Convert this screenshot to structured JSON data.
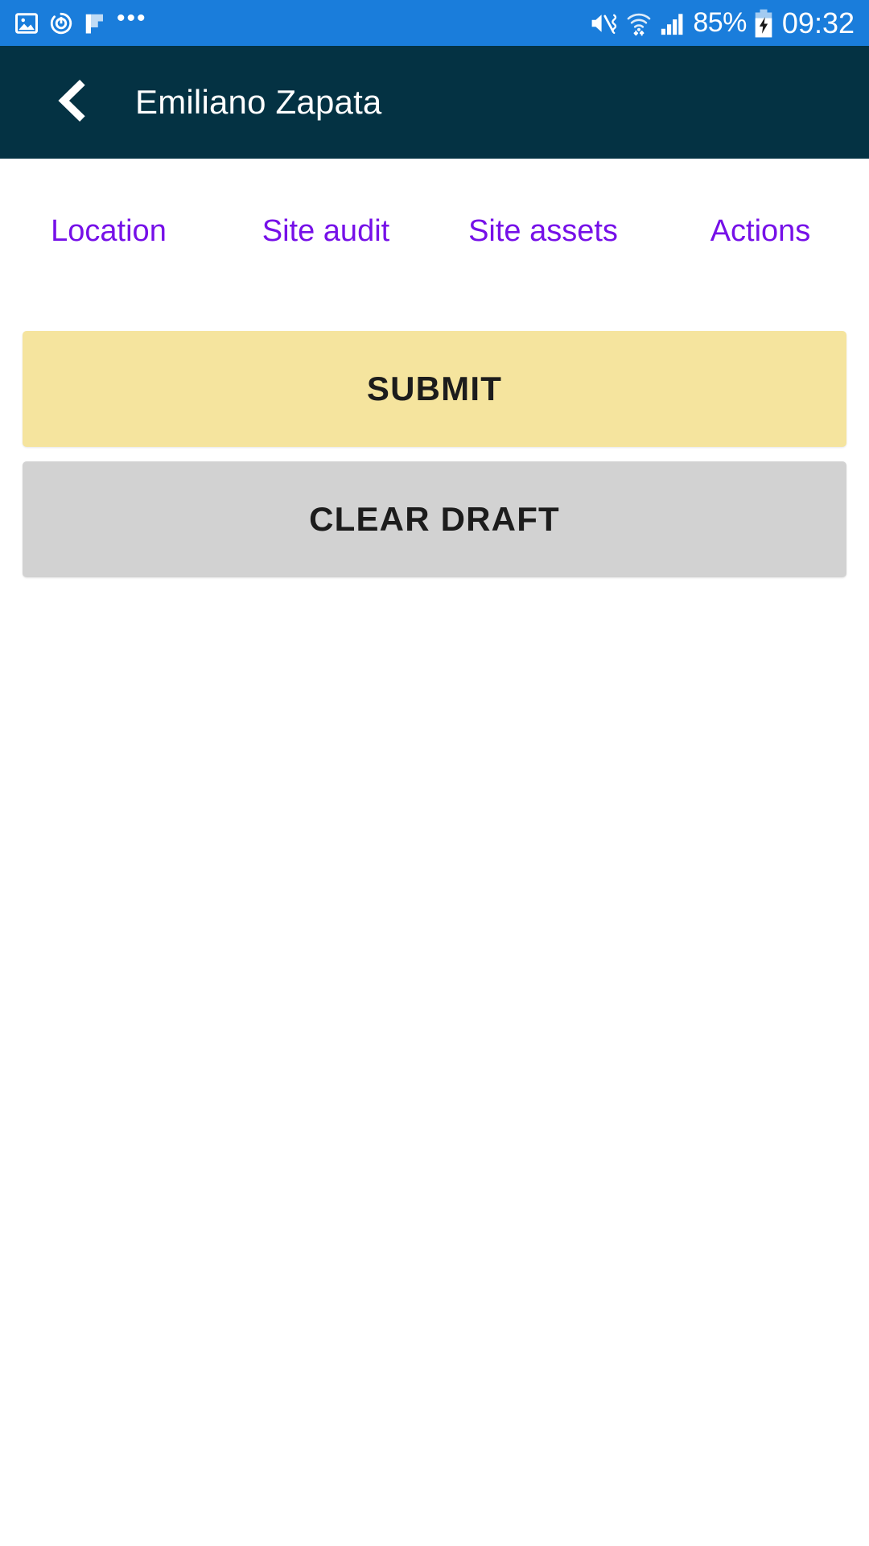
{
  "status_bar": {
    "background_color": "#1a7ddb",
    "left_icons": [
      {
        "name": "image-icon",
        "label": "Screenshot"
      },
      {
        "name": "power-sync-icon",
        "label": "Sync"
      },
      {
        "name": "flag-icon",
        "label": "Notification"
      }
    ],
    "overflow_indicator": "•••",
    "right_icons": [
      {
        "name": "volume-mute-vibrate-icon",
        "label": "Sound off / vibrate"
      },
      {
        "name": "wifi-icon",
        "label": "Wi-Fi connected"
      },
      {
        "name": "cellular-signal-icon",
        "label": "Mobile signal"
      },
      {
        "name": "battery-charging-icon",
        "label": "Battery charging"
      }
    ],
    "battery_percent": "85%",
    "time": "09:32"
  },
  "app_bar": {
    "background_color": "#043243",
    "back_icon": "chevron-left-icon",
    "title": "Emiliano Zapata"
  },
  "tabs": {
    "active_index": 3,
    "active_color": "#6200ee",
    "label_color": "#7610e8",
    "items": [
      {
        "label": "Location"
      },
      {
        "label": "Site audit"
      },
      {
        "label": "Site assets"
      },
      {
        "label": "Actions"
      }
    ]
  },
  "actions": {
    "submit": {
      "label": "SUBMIT",
      "background_color": "#f5e49e",
      "text_color": "#1c1c1c"
    },
    "clear_draft": {
      "label": "CLEAR DRAFT",
      "background_color": "#d2d2d2",
      "text_color": "#1c1c1c"
    }
  }
}
